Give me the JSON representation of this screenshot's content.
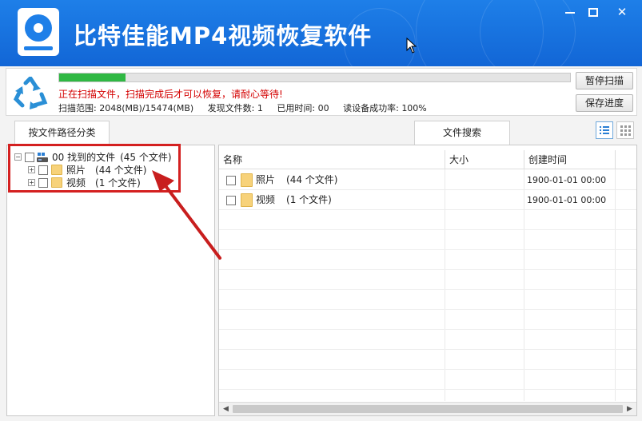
{
  "window": {
    "title": "比特佳能MP4视频恢复软件",
    "minimize_glyph": "—",
    "close_glyph": "✕"
  },
  "status": {
    "progress": 0.13,
    "message": "正在扫描文件，扫描完成后才可以恢复，请耐心等待!",
    "scan_range_label": "扫描范围:",
    "scan_range_value": "2048(MB)/15474(MB)",
    "files_found_label": "发现文件数:",
    "files_found_value": "1",
    "time_used_label": "已用时间:",
    "time_used_value": "00",
    "read_success_label": "读设备成功率:",
    "read_success_value": "100%"
  },
  "buttons": {
    "pause": "暂停扫描",
    "save_progress": "保存进度"
  },
  "tabs": {
    "by_path": "按文件路径分类",
    "search": "文件搜索"
  },
  "tree": {
    "root": {
      "label": "00 找到的文件",
      "count": "(45 个文件)",
      "expander": "−"
    },
    "items": [
      {
        "label": "照片",
        "count": "(44 个文件)",
        "expander": "+"
      },
      {
        "label": "视频",
        "count": "(1 个文件)",
        "expander": "+"
      }
    ]
  },
  "list": {
    "columns": [
      "名称",
      "大小",
      "创建时间"
    ],
    "rows": [
      {
        "name": "照片",
        "count": "(44 个文件)",
        "size": "",
        "created": "1900-01-01  00:00"
      },
      {
        "name": "视频",
        "count": "(1 个文件)",
        "size": "",
        "created": "1900-01-01  00:00"
      }
    ]
  },
  "colors": {
    "titlebar": "#1266d6",
    "progress_fill": "#2fb843",
    "warning_text": "#d40000",
    "annotation": "#d42020"
  },
  "icons": [
    "app-logo-icon",
    "recycle-icon",
    "drive-icon",
    "folder-icon",
    "list-view-icon",
    "grid-view-icon",
    "mouse-cursor-icon",
    "annotation-arrow-icon"
  ]
}
